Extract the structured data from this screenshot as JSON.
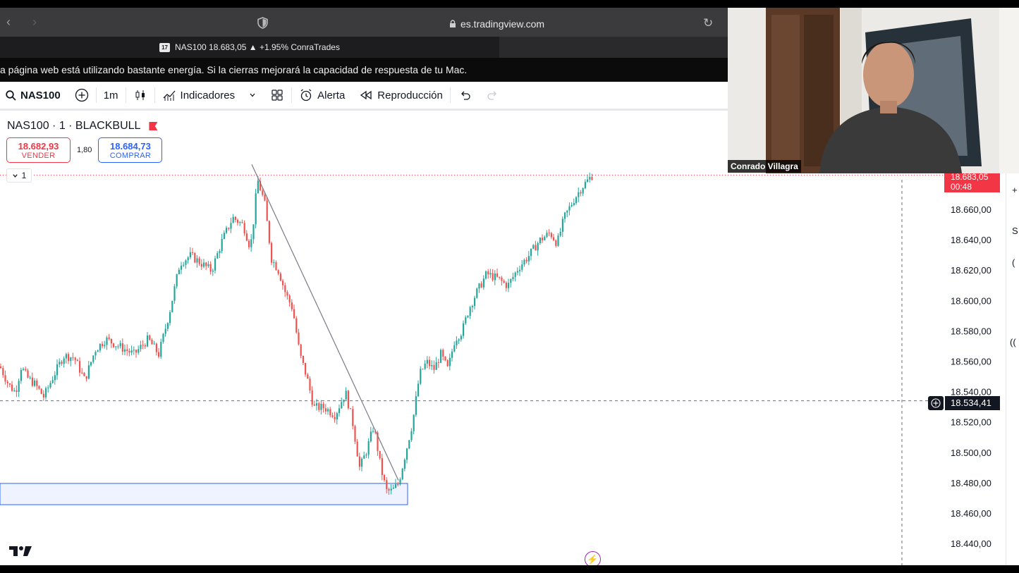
{
  "browser": {
    "url": "es.tradingview.com",
    "tab_title": "NAS100 18.683,05 ▲ +1.95% ConraTrades",
    "energy_warning": "a página web está utilizando bastante energía. Si la cierras mejorará la capacidad de respuesta de tu Mac."
  },
  "toolbar": {
    "symbol": "NAS100",
    "interval": "1m",
    "indicators_label": "Indicadores",
    "alert_label": "Alerta",
    "replay_label": "Reproducción"
  },
  "legend": {
    "title": "NAS100 · 1 · BLACKBULL",
    "sell_price": "18.682,93",
    "sell_label": "VENDER",
    "spread": "1,80",
    "buy_price": "18.684,73",
    "buy_label": "COMPRAR",
    "collapse_count": "1"
  },
  "price_axis": {
    "labels": [
      "18.660,00",
      "18.640,00",
      "18.620,00",
      "18.600,00",
      "18.580,00",
      "18.560,00",
      "18.540,00",
      "18.520,00",
      "18.500,00",
      "18.480,00",
      "18.460,00",
      "18.440,00"
    ],
    "last_price": "18.683,05",
    "countdown": "00:48",
    "crosshair_price": "18.534,41"
  },
  "colors": {
    "up": "#26a69a",
    "down": "#ef5350",
    "last_price_line": "#f23645",
    "zone_border": "#2962ff"
  },
  "webcam": {
    "name": "Conrado Villagra"
  },
  "right_edge_icons": [
    "+",
    "S",
    "(",
    "(("
  ],
  "chart_data": {
    "type": "candlestick",
    "symbol": "NAS100",
    "interval": "1m",
    "ylim": [
      18430,
      18690
    ],
    "path": [
      [
        0,
        18557
      ],
      [
        12,
        18545
      ],
      [
        22,
        18540
      ],
      [
        30,
        18557
      ],
      [
        38,
        18550
      ],
      [
        50,
        18545
      ],
      [
        62,
        18537
      ],
      [
        75,
        18550
      ],
      [
        90,
        18564
      ],
      [
        105,
        18563
      ],
      [
        120,
        18548
      ],
      [
        135,
        18568
      ],
      [
        150,
        18575
      ],
      [
        170,
        18570
      ],
      [
        190,
        18565
      ],
      [
        210,
        18575
      ],
      [
        225,
        18565
      ],
      [
        240,
        18592
      ],
      [
        255,
        18625
      ],
      [
        270,
        18630
      ],
      [
        285,
        18625
      ],
      [
        300,
        18620
      ],
      [
        315,
        18640
      ],
      [
        330,
        18655
      ],
      [
        345,
        18650
      ],
      [
        355,
        18635
      ],
      [
        360,
        18655
      ],
      [
        365,
        18680
      ],
      [
        375,
        18665
      ],
      [
        385,
        18628
      ],
      [
        395,
        18620
      ],
      [
        405,
        18605
      ],
      [
        415,
        18595
      ],
      [
        425,
        18565
      ],
      [
        435,
        18550
      ],
      [
        445,
        18530
      ],
      [
        460,
        18530
      ],
      [
        475,
        18525
      ],
      [
        490,
        18540
      ],
      [
        500,
        18520
      ],
      [
        510,
        18490
      ],
      [
        520,
        18502
      ],
      [
        530,
        18518
      ],
      [
        540,
        18490
      ],
      [
        548,
        18475
      ],
      [
        556,
        18475
      ],
      [
        565,
        18480
      ],
      [
        575,
        18500
      ],
      [
        585,
        18520
      ],
      [
        595,
        18552
      ],
      [
        605,
        18560
      ],
      [
        615,
        18555
      ],
      [
        625,
        18565
      ],
      [
        635,
        18555
      ],
      [
        645,
        18575
      ],
      [
        655,
        18580
      ],
      [
        665,
        18595
      ],
      [
        675,
        18605
      ],
      [
        690,
        18618
      ],
      [
        705,
        18615
      ],
      [
        720,
        18610
      ],
      [
        735,
        18622
      ],
      [
        750,
        18630
      ],
      [
        765,
        18640
      ],
      [
        780,
        18645
      ],
      [
        790,
        18638
      ],
      [
        800,
        18655
      ],
      [
        815,
        18668
      ],
      [
        825,
        18675
      ],
      [
        840,
        18683
      ]
    ],
    "trendline": {
      "from": [
        357,
        18690
      ],
      "to": [
        565,
        18482
      ]
    },
    "demand_zone": {
      "x_from": 0,
      "x_to": 578,
      "y_low": 18466,
      "y_high": 18480
    }
  }
}
